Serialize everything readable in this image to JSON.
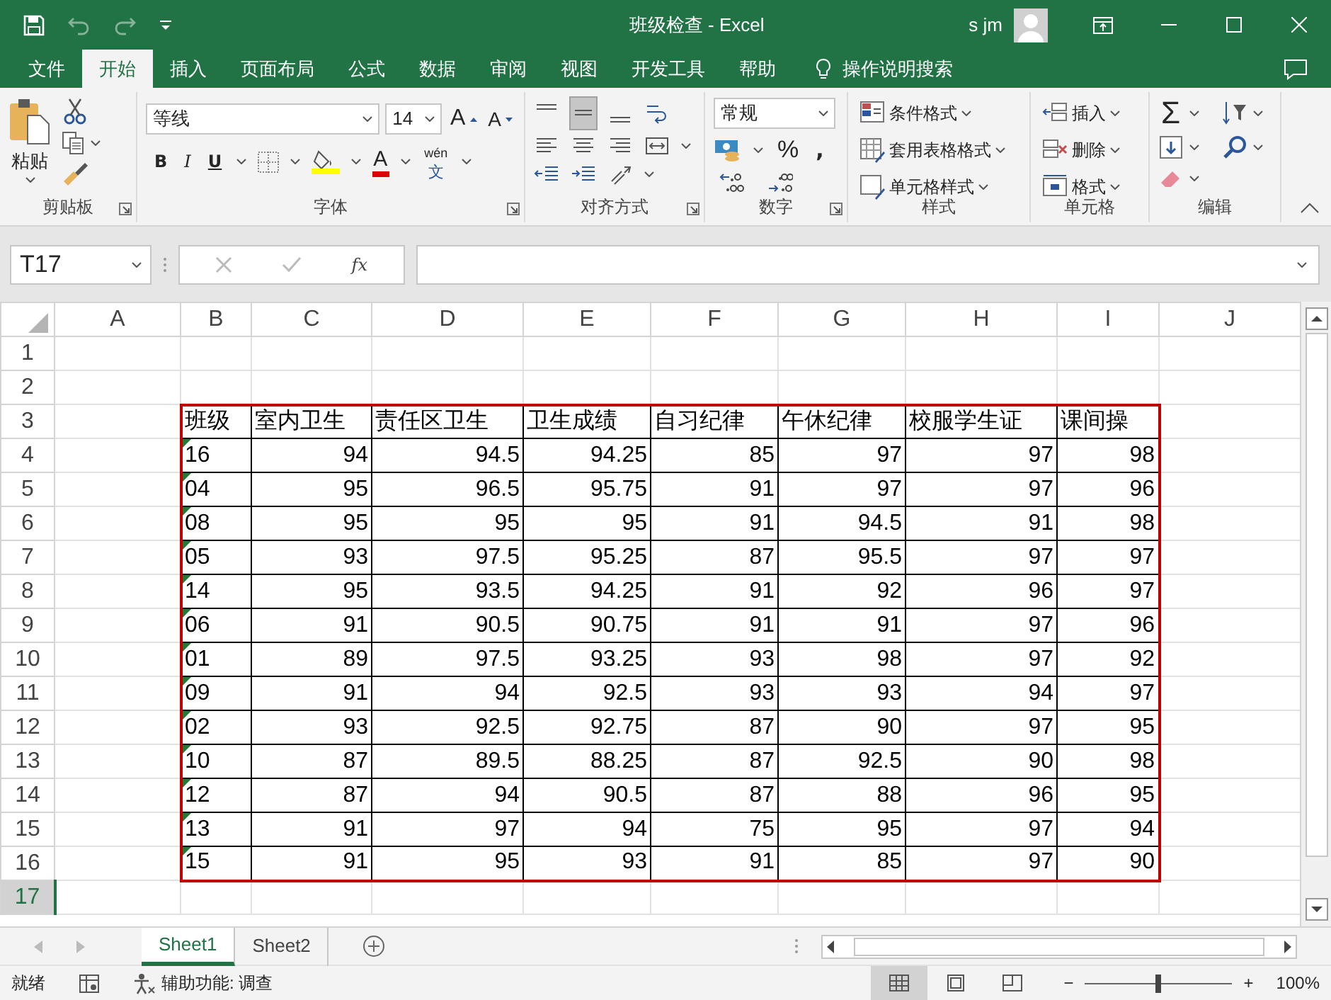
{
  "title_bar": {
    "title": "班级检查  -  Excel",
    "user": "s jm",
    "undo_enabled": false,
    "redo_enabled": false
  },
  "menu_tabs": [
    {
      "label": "文件",
      "selected": false
    },
    {
      "label": "开始",
      "selected": true
    },
    {
      "label": "插入",
      "selected": false
    },
    {
      "label": "页面布局",
      "selected": false
    },
    {
      "label": "公式",
      "selected": false
    },
    {
      "label": "数据",
      "selected": false
    },
    {
      "label": "审阅",
      "selected": false
    },
    {
      "label": "视图",
      "selected": false
    },
    {
      "label": "开发工具",
      "selected": false
    },
    {
      "label": "帮助",
      "selected": false
    }
  ],
  "tell_me": "操作说明搜索",
  "ribbon": {
    "groups": [
      {
        "kind": "clipboard",
        "label": "剪贴板",
        "launcher": true
      },
      {
        "kind": "font",
        "label": "字体",
        "launcher": true
      },
      {
        "kind": "alignment",
        "label": "对齐方式",
        "launcher": true
      },
      {
        "kind": "number",
        "label": "数字",
        "launcher": true
      },
      {
        "kind": "styles",
        "label": "样式",
        "launcher": false
      },
      {
        "kind": "cells",
        "label": "单元格",
        "launcher": false
      },
      {
        "kind": "editing",
        "label": "编辑",
        "launcher": false
      }
    ],
    "paste": "粘贴",
    "font_name": "等线",
    "font_size": "14",
    "grow_font": "A",
    "shrink_font": "A",
    "bold": "B",
    "italic": "I",
    "underline": "U",
    "font_color": "A",
    "phonetic_top": "wén",
    "phonetic_bottom": "文",
    "middle_align_pressed": true,
    "number_format": "常规",
    "percent": "%",
    "comma": ",",
    "style_buttons": [
      "条件格式",
      "套用表格格式",
      "单元格样式"
    ],
    "cell_buttons": [
      "插入",
      "删除",
      "格式"
    ],
    "sum": "Σ"
  },
  "formula_bar": {
    "name_box": "T17",
    "fx": "fx"
  },
  "sheet": {
    "columns": [
      "A",
      "B",
      "C",
      "D",
      "E",
      "F",
      "G",
      "H",
      "I",
      "J"
    ],
    "rows": [
      {
        "header": "1",
        "selected": false,
        "kind": "empty"
      },
      {
        "header": "2",
        "selected": false,
        "kind": "empty"
      },
      {
        "header": "3",
        "selected": false,
        "kind": "header",
        "cells": [
          "班级",
          "室内卫生",
          "责任区卫生",
          "卫生成绩",
          "自习纪律",
          "午休纪律",
          "校服学生证",
          "课间操"
        ]
      },
      {
        "header": "4",
        "selected": false,
        "kind": "data",
        "flagged": true,
        "cells": [
          "16",
          "94",
          "94.5",
          "94.25",
          "85",
          "97",
          "97",
          "98"
        ]
      },
      {
        "header": "5",
        "selected": false,
        "kind": "data",
        "flagged": true,
        "cells": [
          "04",
          "95",
          "96.5",
          "95.75",
          "91",
          "97",
          "97",
          "96"
        ]
      },
      {
        "header": "6",
        "selected": false,
        "kind": "data",
        "flagged": true,
        "cells": [
          "08",
          "95",
          "95",
          "95",
          "91",
          "94.5",
          "91",
          "98"
        ]
      },
      {
        "header": "7",
        "selected": false,
        "kind": "data",
        "flagged": true,
        "cells": [
          "05",
          "93",
          "97.5",
          "95.25",
          "87",
          "95.5",
          "97",
          "97"
        ]
      },
      {
        "header": "8",
        "selected": false,
        "kind": "data",
        "flagged": true,
        "cells": [
          "14",
          "95",
          "93.5",
          "94.25",
          "91",
          "92",
          "96",
          "97"
        ]
      },
      {
        "header": "9",
        "selected": false,
        "kind": "data",
        "flagged": true,
        "cells": [
          "06",
          "91",
          "90.5",
          "90.75",
          "91",
          "91",
          "97",
          "96"
        ]
      },
      {
        "header": "10",
        "selected": false,
        "kind": "data",
        "flagged": true,
        "cells": [
          "01",
          "89",
          "97.5",
          "93.25",
          "93",
          "98",
          "97",
          "92"
        ]
      },
      {
        "header": "11",
        "selected": false,
        "kind": "data",
        "flagged": true,
        "cells": [
          "09",
          "91",
          "94",
          "92.5",
          "93",
          "93",
          "94",
          "97"
        ]
      },
      {
        "header": "12",
        "selected": false,
        "kind": "data",
        "flagged": true,
        "cells": [
          "02",
          "93",
          "92.5",
          "92.75",
          "87",
          "90",
          "97",
          "95"
        ]
      },
      {
        "header": "13",
        "selected": false,
        "kind": "data",
        "flagged": true,
        "cells": [
          "10",
          "87",
          "89.5",
          "88.25",
          "87",
          "92.5",
          "90",
          "98"
        ]
      },
      {
        "header": "14",
        "selected": false,
        "kind": "data",
        "flagged": true,
        "cells": [
          "12",
          "87",
          "94",
          "90.5",
          "87",
          "88",
          "96",
          "95"
        ]
      },
      {
        "header": "15",
        "selected": false,
        "kind": "data",
        "flagged": true,
        "cells": [
          "13",
          "91",
          "97",
          "94",
          "75",
          "95",
          "97",
          "94"
        ]
      },
      {
        "header": "16",
        "selected": false,
        "kind": "data",
        "flagged": true,
        "cells": [
          "15",
          "91",
          "95",
          "93",
          "91",
          "85",
          "97",
          "90"
        ]
      },
      {
        "header": "17",
        "selected": true,
        "kind": "empty"
      }
    ]
  },
  "sheet_tabs": [
    {
      "label": "Sheet1",
      "selected": true
    },
    {
      "label": "Sheet2",
      "selected": false
    }
  ],
  "status_bar": {
    "mode": "就绪",
    "accessibility": "辅助功能: 调查",
    "views": [
      {
        "kind": "normal",
        "selected": true
      },
      {
        "kind": "page_layout",
        "selected": false
      },
      {
        "kind": "page_break",
        "selected": false
      }
    ],
    "zoom_minus": "−",
    "zoom_plus": "+",
    "zoom": {
      "level": 0.5
    },
    "zoom_label": "100%"
  }
}
